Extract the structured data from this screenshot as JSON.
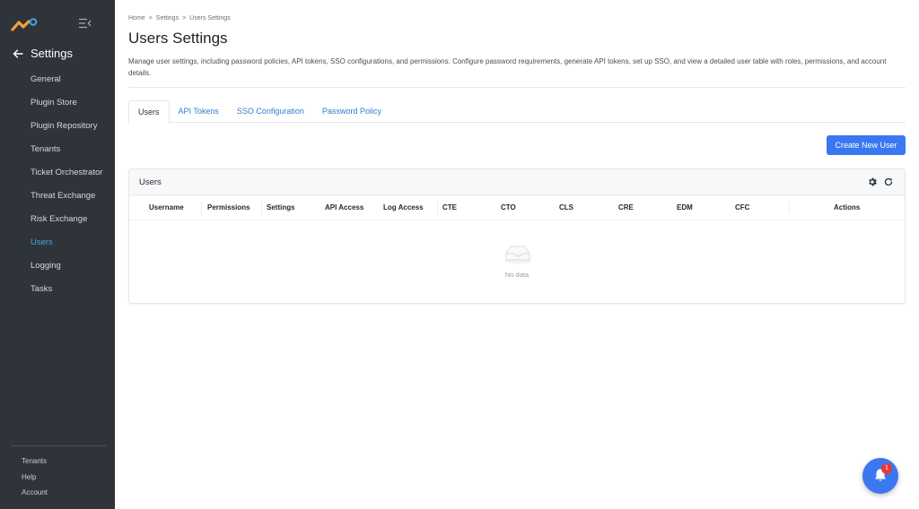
{
  "sidebar": {
    "back_label": "Settings",
    "items": [
      {
        "label": "General",
        "active": false
      },
      {
        "label": "Plugin Store",
        "active": false
      },
      {
        "label": "Plugin Repository",
        "active": false
      },
      {
        "label": "Tenants",
        "active": false
      },
      {
        "label": "Ticket Orchestrator",
        "active": false
      },
      {
        "label": "Threat Exchange",
        "active": false
      },
      {
        "label": "Risk Exchange",
        "active": false
      },
      {
        "label": "Users",
        "active": true
      },
      {
        "label": "Logging",
        "active": false
      },
      {
        "label": "Tasks",
        "active": false
      }
    ],
    "footer": [
      "Tenants",
      "Help",
      "Account"
    ]
  },
  "breadcrumb": [
    "Home",
    "Settings",
    "Users Settings"
  ],
  "breadcrumb_separator": ">",
  "page": {
    "title": "Users Settings",
    "description": "Manage user settings, including password policies, API tokens, SSO configurations, and permissions. Configure password requirements, generate API tokens, set up SSO, and view a detailed user table with roles, permissions, and account details."
  },
  "tabs": [
    {
      "label": "Users",
      "active": true
    },
    {
      "label": "API Tokens",
      "active": false
    },
    {
      "label": "SSO Configuration",
      "active": false
    },
    {
      "label": "Password Policy",
      "active": false
    }
  ],
  "create_button": "Create New User",
  "users_panel": {
    "title": "Users",
    "columns": [
      "Username",
      "Permissions",
      "Settings",
      "API Access",
      "Log Access",
      "CTE",
      "CTO",
      "CLS",
      "CRE",
      "EDM",
      "CFC",
      "Actions"
    ],
    "empty_text": "No data"
  },
  "notifications": {
    "count": "1"
  },
  "colors": {
    "sidebar_bg": "#2f343b",
    "accent": "#3a78f2",
    "active_nav": "#4aa3df",
    "badge": "#e53935"
  }
}
